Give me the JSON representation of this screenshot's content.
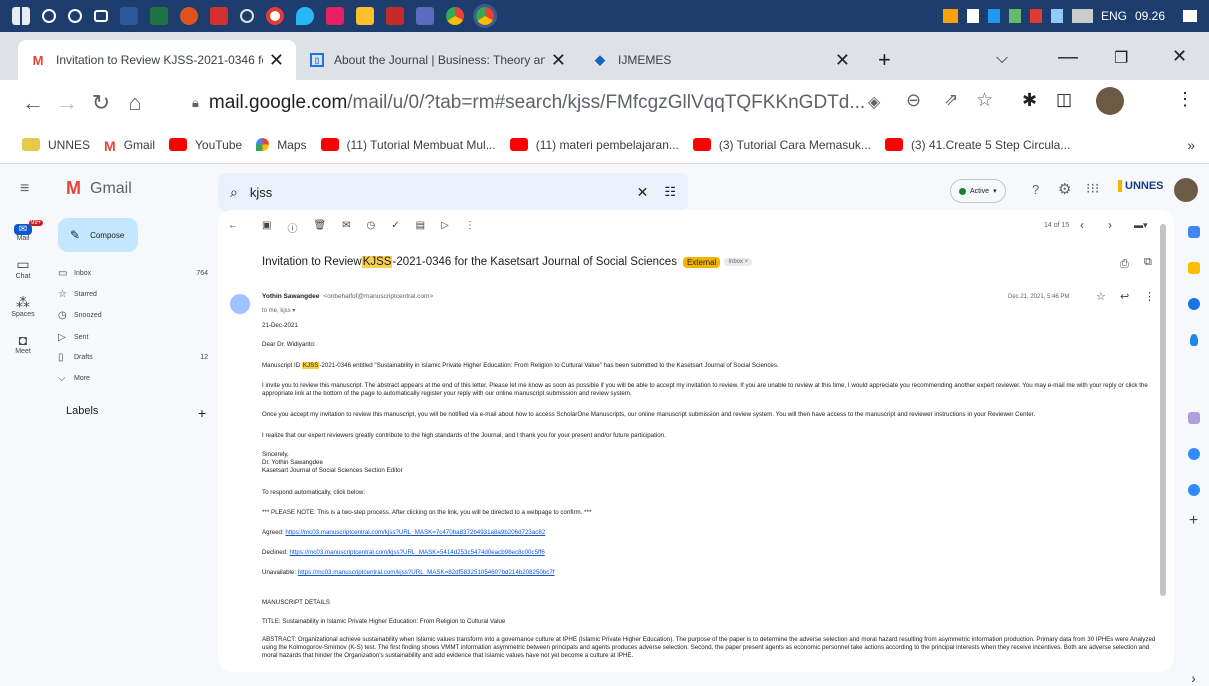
{
  "taskbar": {
    "lang": "ENG",
    "time": "09.26"
  },
  "tabs": [
    {
      "label": "Invitation to Review KJSS-2021-0346 fo",
      "active": true
    },
    {
      "label": "About the Journal | Business: Theory an",
      "active": false
    },
    {
      "label": "IJMEMES",
      "active": false
    }
  ],
  "url": {
    "host": "mail.google.com",
    "path": "/mail/u/0/?tab=rm#search/kjss/FMfcgzGllVqqTQFKKnGDTd..."
  },
  "bookmarks": [
    "UNNES",
    "Gmail",
    "YouTube",
    "Maps",
    "(11) Tutorial Membuat Mul...",
    "(11) materi pembelajaran...",
    "(3) Tutorial Cara Memasuk...",
    "(3) 41.Create 5 Step Circula..."
  ],
  "gmail": {
    "logo": "Gmail",
    "search_value": "kjss",
    "status": "Active",
    "unnes": "UNNES",
    "rail": [
      {
        "label": "Mail",
        "badge": "99+"
      },
      {
        "label": "Chat"
      },
      {
        "label": "Spaces"
      },
      {
        "label": "Meet"
      }
    ],
    "compose": "Compose",
    "nav": [
      {
        "label": "Inbox",
        "count": "764"
      },
      {
        "label": "Starred",
        "count": ""
      },
      {
        "label": "Snoozed",
        "count": ""
      },
      {
        "label": "Sent",
        "count": ""
      },
      {
        "label": "Drafts",
        "count": "12"
      },
      {
        "label": "More",
        "count": ""
      }
    ],
    "labels": "Labels",
    "pager": "14 of 15"
  },
  "email": {
    "subject_pre": "Invitation to Review ",
    "subject_hl": "KJSS",
    "subject_post": "-2021-0346 for the Kasetsart Journal of Social Sciences",
    "tag_external": "External",
    "tag_inbox": "Inbox ×",
    "sender": "Yothin Sawangdee",
    "sender_email": "<onbehalfof@manuscriptcentral.com>",
    "to": "to me, kjss ▾",
    "date": "Dec 21, 2021, 5:46 PM",
    "date_line": "21-Dec-2021",
    "greeting": "Dear Dr. Widiyanto:",
    "p1_pre": "Manuscript ID ",
    "p1_hl": "KJSS",
    "p1_post": "-2021-0346 entitled \"Sustainability in Islamic Private Higher Education: From Religion to Cultural Value\" has been submitted to the Kasetsart Journal of Social Sciences.",
    "p2": "I invite you to review this manuscript.  The abstract appears at the end of this letter.  Please let me know as soon as possible if you will be able to accept my invitation to review.  If you are unable to review at this time, I would appreciate you recommending another expert reviewer.  You may e-mail me with your reply or click the appropriate link at the bottom of the page to automatically register your reply with our online manuscript submission and review system.",
    "p3": "Once you accept my invitation to review this manuscript, you will be notified via e-mail about how to access ScholarOne Manuscripts, our online manuscript submission and review system.  You will then have access to the manuscript and reviewer instructions in your Reviewer Center.",
    "p4": "I realize that our expert reviewers greatly contribute to the high standards of the Journal, and I thank you for your present and/or future participation.",
    "sig1": "Sincerely,",
    "sig2": "Dr. Yothin Sawangdee",
    "sig3": "Kasetsart Journal of Social Sciences Section Editor",
    "respond": "To respond automatically, click below:",
    "note": "*** PLEASE NOTE: This is a two-step process. After clicking on the link, you will be directed to a webpage to confirm. ***",
    "agreed_label": "Agreed: ",
    "agreed_link": "https://mc03.manuscriptcentral.com/kjss?URL_MASK=7c470ba8372b4931a8a9b206d723ac82",
    "declined_label": "Declined: ",
    "declined_link": "https://mc03.manuscriptcentral.com/kjss?URL_MASK=5414d253c5474d0eacb98ec8c00c5ff6",
    "unavailable_label": "Unavailable: ",
    "unavailable_link": "https://mc03.manuscriptcentral.com/kjss?URL_MASK=82df58325105460?bd214b208250bc7f",
    "details": "MANUSCRIPT DETAILS",
    "title_line": "TITLE: Sustainability in Islamic Private Higher Education: From Religion to Cultural Value",
    "abstract": "ABSTRACT: Organizational achieve sustainability when Islamic values transform into a governance culture at IPHE (Islamic Private Higher Education). The purpose of the paper is to determine the adverse selection and moral hazard resulting from asymmetric information production. Primary data from 30 IPHEs were Analyzed using the Kolmogorov-Smirnov (K-S) test. The first finding shows VMMT information asymmetric between principals and agents produces adverse selection. Second, the paper present agents as economic personnel take actions according to the principal interests when they receive incentives. Both are adverse selection and moral hazards that hinder the Organization's sustainability and add evidence that Islamic values have not yet become a culture at IPHE."
  }
}
